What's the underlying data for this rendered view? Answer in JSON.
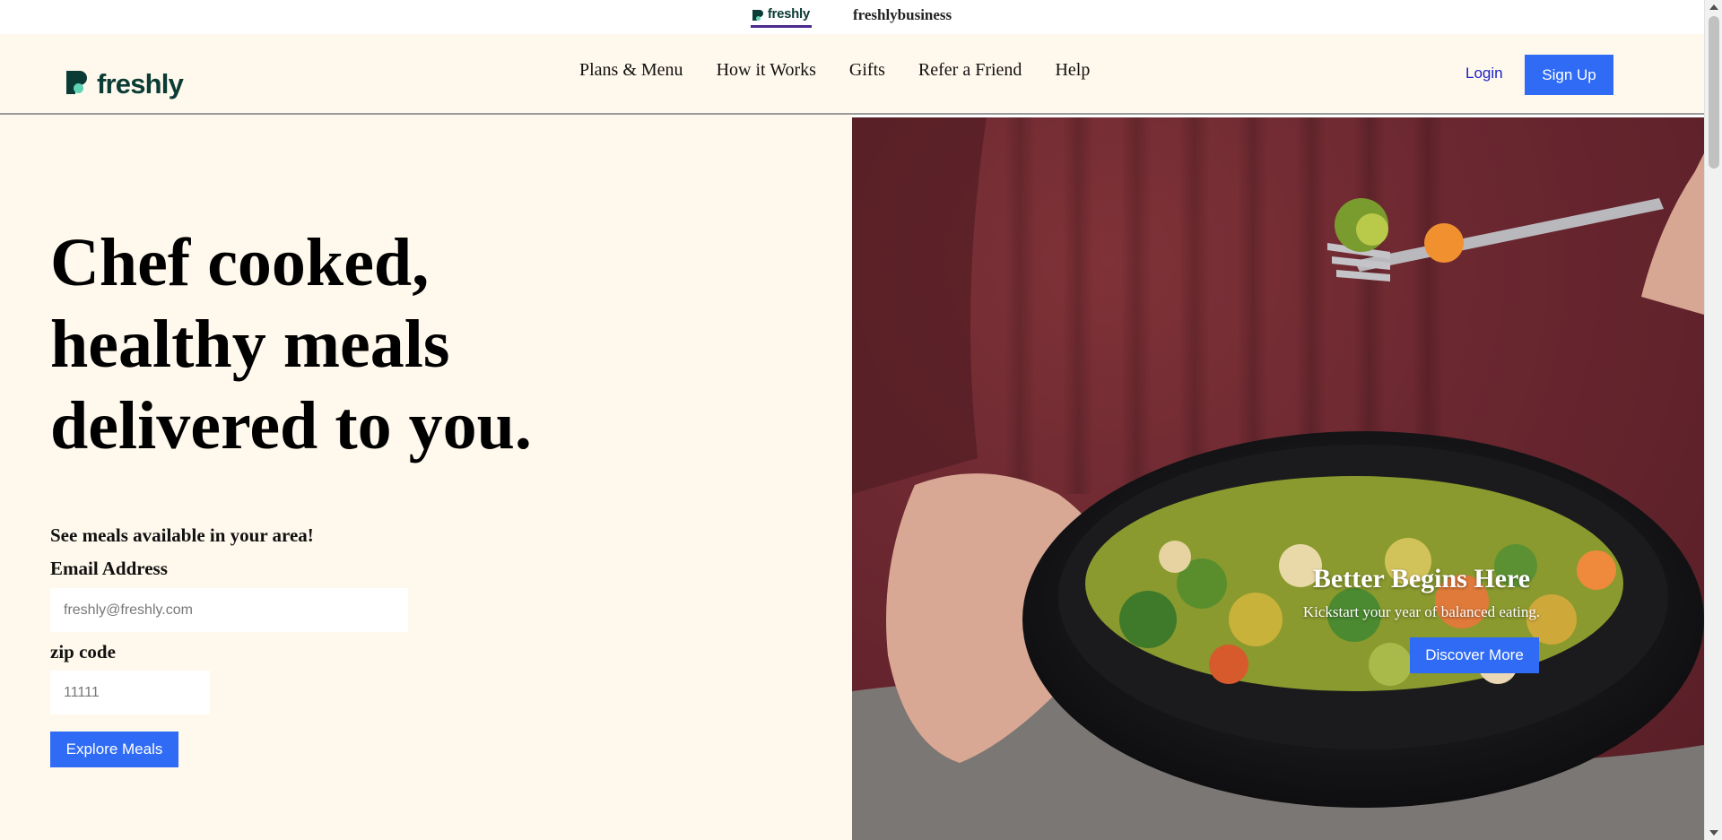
{
  "brand_switcher": {
    "tabs": [
      {
        "label": "freshly",
        "active": true
      },
      {
        "label": "freshlybusiness",
        "active": false
      }
    ],
    "active_underline_color": "#4b2a8e"
  },
  "header": {
    "logo_text": "freshly",
    "nav": [
      {
        "label": "Plans & Menu"
      },
      {
        "label": "How it Works"
      },
      {
        "label": "Gifts"
      },
      {
        "label": "Refer a Friend"
      },
      {
        "label": "Help"
      }
    ],
    "login_label": "Login",
    "signup_label": "Sign Up"
  },
  "hero": {
    "headline_lines": [
      "Chef cooked,",
      "healthy meals",
      "delivered to you."
    ],
    "prompt": "See meals available in your area!",
    "email": {
      "label": "Email Address",
      "placeholder": "freshly@freshly.com",
      "value": ""
    },
    "zip": {
      "label": "zip code",
      "placeholder": "11111",
      "value": ""
    },
    "cta_label": "Explore Meals"
  },
  "promo": {
    "title": "Better Begins Here",
    "subtitle": "Kickstart your year of balanced eating.",
    "cta_label": "Discover More"
  },
  "colors": {
    "brand_dark": "#0b3b35",
    "brand_mint": "#5fd3b4",
    "accent_blue": "#2f6bf5",
    "cream_bg": "#fff8ec",
    "link_blue": "#1a24c7",
    "sweater_burgundy": "#6a2730"
  },
  "icons": {
    "logo_mark": "freshly-logo-icon",
    "scroll_up": "scroll-up-arrow-icon",
    "scroll_down": "scroll-down-arrow-icon"
  }
}
